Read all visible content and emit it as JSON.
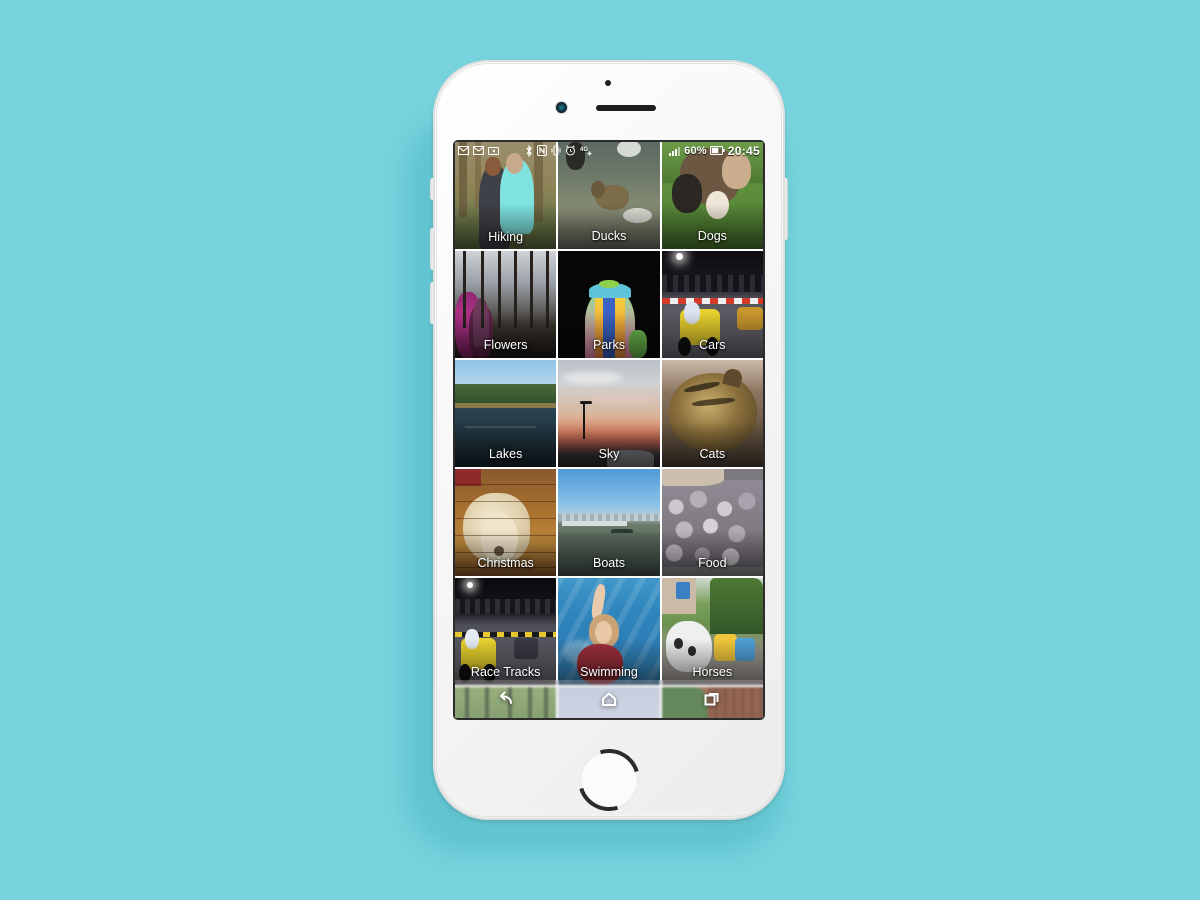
{
  "scene": {
    "background_color": "#77d4de",
    "device": "white smartphone mockup",
    "shadow_color": "#4fb5c2"
  },
  "statusbar": {
    "left_icons": [
      {
        "name": "gmail-icon",
        "glyph": "M"
      },
      {
        "name": "gmail-icon",
        "glyph": "M"
      },
      {
        "name": "camera-icon",
        "glyph": "camera"
      }
    ],
    "middle_icons": [
      {
        "name": "bluetooth-icon",
        "glyph": "bluetooth"
      },
      {
        "name": "nfc-icon",
        "glyph": "N"
      },
      {
        "name": "vibrate-icon",
        "glyph": "vibrate"
      },
      {
        "name": "alarm-icon",
        "glyph": "alarm"
      },
      {
        "name": "network-4g-icon",
        "label": "4G"
      }
    ],
    "signal_label": "",
    "battery_percent": "60%",
    "clock": "20:45"
  },
  "albums": [
    {
      "label": "Hiking",
      "art": "a-hiking"
    },
    {
      "label": "Ducks",
      "art": "a-ducks"
    },
    {
      "label": "Dogs",
      "art": "a-dogs"
    },
    {
      "label": "Flowers",
      "art": "a-flowers"
    },
    {
      "label": "Parks",
      "art": "a-parks"
    },
    {
      "label": "Cars",
      "art": "a-cars"
    },
    {
      "label": "Lakes",
      "art": "a-lakes"
    },
    {
      "label": "Sky",
      "art": "a-sky"
    },
    {
      "label": "Cats",
      "art": "a-cats"
    },
    {
      "label": "Christmas",
      "art": "a-christmas"
    },
    {
      "label": "Boats",
      "art": "a-boats"
    },
    {
      "label": "Food",
      "art": "a-food"
    },
    {
      "label": "Race Tracks",
      "art": "a-race"
    },
    {
      "label": "Swimming",
      "art": "a-swim"
    },
    {
      "label": "Horses",
      "art": "a-horses"
    },
    {
      "label": "",
      "art": "a-forest"
    },
    {
      "label": "",
      "art": "a-skyb"
    },
    {
      "label": "",
      "art": "a-garden"
    }
  ],
  "navbar": {
    "items": [
      {
        "name": "nav-back-button",
        "label": "Back"
      },
      {
        "name": "nav-home-button",
        "label": "Home"
      },
      {
        "name": "nav-recents-button",
        "label": "Recents"
      }
    ]
  }
}
